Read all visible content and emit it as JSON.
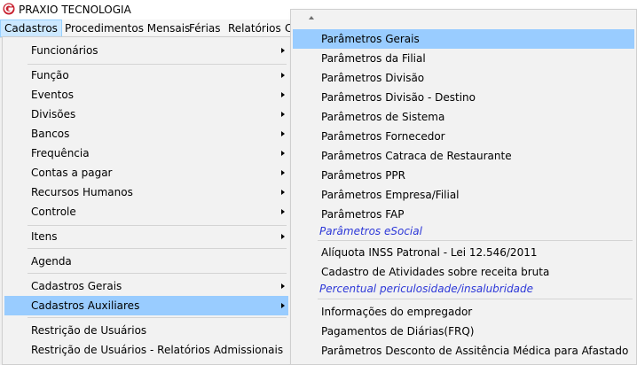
{
  "app": {
    "title": "PRAXIO TECNOLOGIA"
  },
  "menubar": {
    "items": [
      "Cadastros",
      "Procedimentos Mensais",
      "Férias",
      "Relatórios",
      "C"
    ]
  },
  "left_menu": {
    "items": [
      {
        "label": "Funcionários",
        "submenu": true
      },
      {
        "label": "Função",
        "submenu": true
      },
      {
        "label": "Eventos",
        "submenu": true
      },
      {
        "label": "Divisões",
        "submenu": true
      },
      {
        "label": "Bancos",
        "submenu": true
      },
      {
        "label": "Frequência",
        "submenu": true
      },
      {
        "label": "Contas a pagar",
        "submenu": true
      },
      {
        "label": "Recursos Humanos",
        "submenu": true
      },
      {
        "label": "Controle",
        "submenu": true
      },
      {
        "label": "Itens",
        "submenu": true
      },
      {
        "label": "Agenda",
        "submenu": false
      },
      {
        "label": "Cadastros Gerais",
        "submenu": true
      },
      {
        "label": "Cadastros Auxiliares",
        "submenu": true
      },
      {
        "label": "Restrição de Usuários",
        "submenu": false
      },
      {
        "label": "Restrição de Usuários - Relatórios Admissionais",
        "submenu": false
      }
    ],
    "highlighted": "Cadastros Auxiliares"
  },
  "right_menu": {
    "items": [
      "Parâmetros Gerais",
      "Parâmetros da Filial",
      "Parâmetros Divisão",
      "Parâmetros Divisão - Destino",
      "Parâmetros de Sistema",
      "Parâmetros Fornecedor",
      "Parâmetros Catraca de Restaurante",
      "Parâmetros PPR",
      "Parâmetros Empresa/Filial",
      "Parâmetros FAP"
    ],
    "section_esocial": "Parâmetros eSocial",
    "esocial_items": [
      "Alíquota INSS Patronal - Lei 12.546/2011",
      "Cadastro de Atividades sobre receita bruta"
    ],
    "section_periculosidade": "Percentual periculosidade/insalubridade",
    "periculosidade_items": [
      "Informações do empregador",
      "Pagamentos de Diárias(FRQ)",
      "Parâmetros Desconto de Assitência Médica para Afastado"
    ],
    "highlighted": "Parâmetros Gerais"
  },
  "colors": {
    "highlight": "#99ccff",
    "section_text": "#2d38d8",
    "logo": "#c8202f"
  }
}
